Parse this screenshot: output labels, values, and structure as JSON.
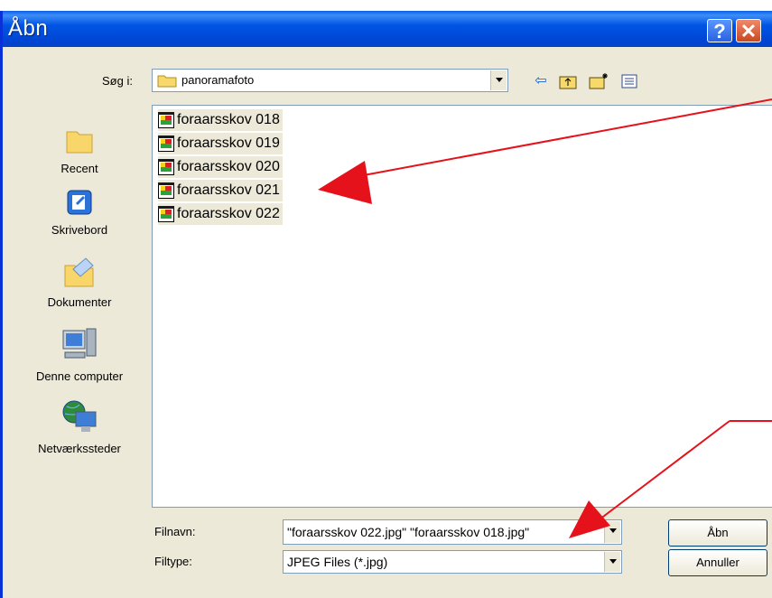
{
  "window": {
    "title": "Åbn",
    "help_label": "?",
    "close_label": "✕"
  },
  "look_in": {
    "label": "Søg i:",
    "value": "panoramafoto"
  },
  "toolbar": {
    "back_icon": "back-arrow-icon",
    "up_icon": "up-folder-icon",
    "new_folder_icon": "new-folder-icon",
    "view_icon": "view-menu-icon"
  },
  "places": [
    {
      "label": "Recent",
      "icon": "recent-folder-icon"
    },
    {
      "label": "Skrivebord",
      "icon": "desktop-icon"
    },
    {
      "label": "Dokumenter",
      "icon": "documents-folder-icon"
    },
    {
      "label": "Denne computer",
      "icon": "computer-icon"
    },
    {
      "label": "Netværkssteder",
      "icon": "network-icon"
    }
  ],
  "files": [
    {
      "name": "foraarsskov 018"
    },
    {
      "name": "foraarsskov 019"
    },
    {
      "name": "foraarsskov 020"
    },
    {
      "name": "foraarsskov 021"
    },
    {
      "name": "foraarsskov 022"
    }
  ],
  "filename": {
    "label": "Filnavn:",
    "value": "\"foraarsskov 022.jpg\" \"foraarsskov 018.jpg\""
  },
  "filetype": {
    "label": "Filtype:",
    "value": "JPEG Files (*.jpg)"
  },
  "buttons": {
    "open": "Åbn",
    "cancel": "Annuller"
  },
  "colors": {
    "titlebar": "#0054e3",
    "dialog_bg": "#ece9d8",
    "annotation": "#e5121b"
  }
}
